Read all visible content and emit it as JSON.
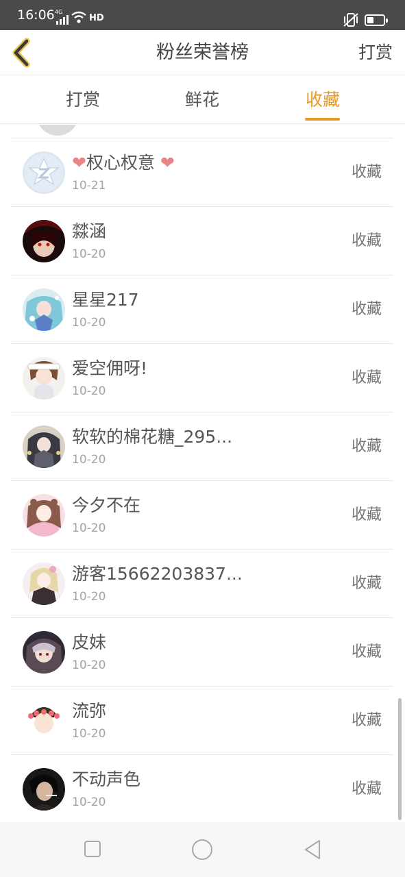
{
  "status_bar": {
    "time": "16:06",
    "signal_label": "4G",
    "hd_label": "HD",
    "battery_icon": "battery-low-icon"
  },
  "header": {
    "title": "粉丝荣誉榜",
    "action_label": "打赏",
    "back_icon": "chevron-left-icon"
  },
  "tabs": [
    {
      "label": "打赏",
      "active": false
    },
    {
      "label": "鲜花",
      "active": false
    },
    {
      "label": "收藏",
      "active": true
    }
  ],
  "colors": {
    "accent": "#e89a24",
    "status_bar": "#4a4a4a",
    "divider": "#e6e6e6",
    "date": "#a3a3a3",
    "heart": "#e88585"
  },
  "fans": [
    {
      "name": "权心权意",
      "name_decoration": "heart",
      "date": "10-21",
      "action": "收藏",
      "avatar": "qq-default-avatar"
    },
    {
      "name": "㵘涵",
      "date": "10-20",
      "action": "收藏",
      "avatar": "dark-red-anime-avatar"
    },
    {
      "name": "星星217",
      "date": "10-20",
      "action": "收藏",
      "avatar": "blue-anime-avatar"
    },
    {
      "name": "爱空佣呀!",
      "date": "10-20",
      "action": "收藏",
      "avatar": "brown-hair-anime-avatar"
    },
    {
      "name": "软软的棉花糖_295...",
      "date": "10-20",
      "action": "收藏",
      "avatar": "dark-dress-anime-avatar"
    },
    {
      "name": "今夕不在",
      "date": "10-20",
      "action": "收藏",
      "avatar": "pink-anime-avatar"
    },
    {
      "name": "游客15662203837...",
      "date": "10-20",
      "action": "收藏",
      "avatar": "lolita-anime-avatar"
    },
    {
      "name": "皮妹",
      "date": "10-20",
      "action": "收藏",
      "avatar": "dark-hair-anime-avatar"
    },
    {
      "name": "流弥",
      "date": "10-20",
      "action": "收藏",
      "avatar": "flower-crown-avatar"
    },
    {
      "name": "不动声色",
      "date": "10-20",
      "action": "收藏",
      "avatar": "photo-person-avatar"
    }
  ],
  "nav_bar": {
    "recent_icon": "square-icon",
    "home_icon": "circle-icon",
    "back_icon": "triangle-back-icon"
  }
}
